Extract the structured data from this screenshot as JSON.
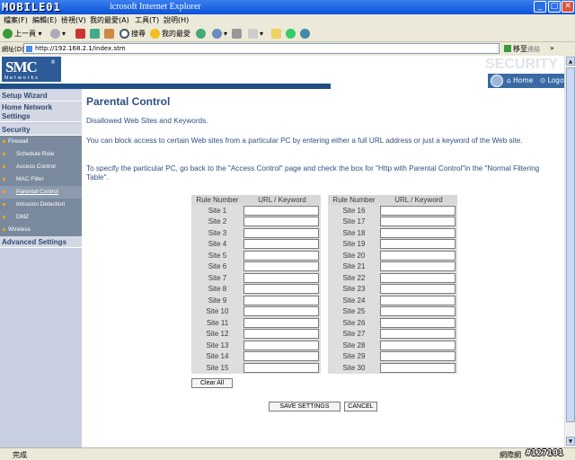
{
  "browser": {
    "watermark": "MOBILE01",
    "title": "icrosoft Internet Explorer",
    "menu": [
      "檔案(F)",
      "編輯(E)",
      "檢視(V)",
      "我的最愛(A)",
      "工具(T)",
      "說明(H)"
    ],
    "toolbar": {
      "back": "上一頁",
      "search": "搜尋",
      "favorites": "我的最愛"
    },
    "address_label": "網址(D)",
    "address": "http://192.168.2.1/index.stm",
    "go": "移至",
    "links": "連結"
  },
  "header": {
    "logo": "SMC",
    "logo_sub": "Networks",
    "security_label": "SECURITY",
    "home": "Home",
    "logout": "Logout"
  },
  "sidebar": {
    "setup_wizard": "Setup Wizard",
    "home_network": "Home Network Settings",
    "security": "Security",
    "firewall": "Firewall",
    "items": [
      "Schedule Rule",
      "Access Control",
      "MAC Filter",
      "Parental Control",
      "Intrusion Detection",
      "DMZ"
    ],
    "wireless": "Wireless",
    "advanced": "Advanced Settings"
  },
  "main": {
    "title": "Parental Control",
    "subtitle": "Disallowed Web Sites and Keywords.",
    "desc1": "You can block access to certain Web sites from a particular PC by entering either a full URL address or just a keyword of the Web site.",
    "desc2": "To specify the particular PC, go back to the \"Access Control\" page and check the box for \"Http with Parental Control\"in the \"Normal Filtering Table\".",
    "col_rule": "Rule Number",
    "col_url": "URL / Keyword",
    "sites_left": [
      "Site  1",
      "Site  2",
      "Site  3",
      "Site  4",
      "Site  5",
      "Site  6",
      "Site  7",
      "Site  8",
      "Site  9",
      "Site  10",
      "Site  11",
      "Site  12",
      "Site  13",
      "Site  14",
      "Site  15"
    ],
    "sites_right": [
      "Site  16",
      "Site  17",
      "Site  18",
      "Site  19",
      "Site  20",
      "Site  21",
      "Site  22",
      "Site  23",
      "Site  24",
      "Site  25",
      "Site  26",
      "Site  27",
      "Site  28",
      "Site  29",
      "Site  30"
    ],
    "clear_all": "Clear All",
    "save": "SAVE SETTINGS",
    "cancel": "CANCEL"
  },
  "status": {
    "text": "完成",
    "zone": "網際網",
    "watermark": "#127101"
  }
}
